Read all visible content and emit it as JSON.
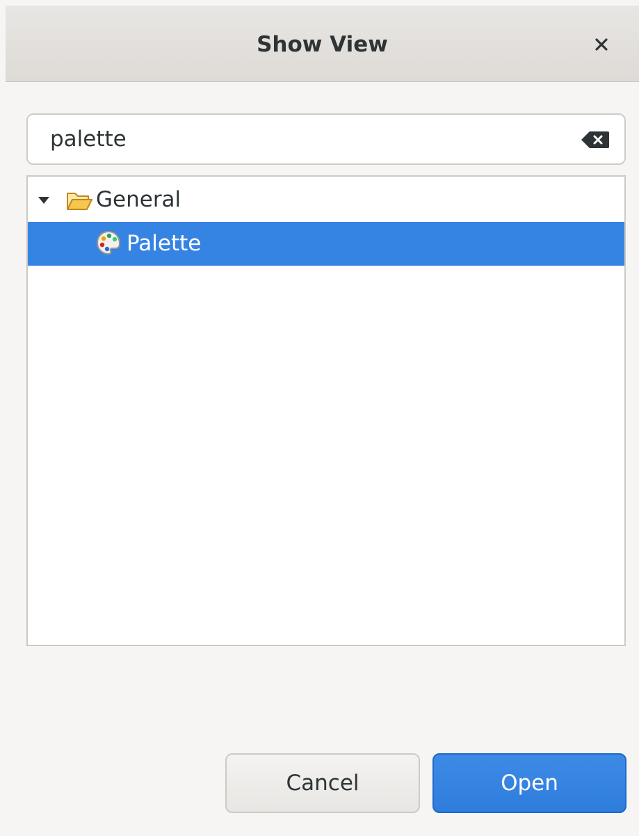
{
  "dialog": {
    "title": "Show View",
    "close_icon": "close-icon"
  },
  "search": {
    "value": "palette",
    "clear_icon": "clear-text-icon"
  },
  "tree": {
    "items": [
      {
        "label": "General",
        "icon": "folder-open-icon",
        "expanded": true,
        "selected": false,
        "children": [
          {
            "label": "Palette",
            "icon": "palette-icon",
            "selected": true
          }
        ]
      }
    ]
  },
  "buttons": {
    "cancel_label": "Cancel",
    "open_label": "Open"
  },
  "colors": {
    "selection": "#3584e4",
    "primary_button": "#3584e4",
    "title_text": "#2e3436",
    "folder": "#e5a50a"
  }
}
